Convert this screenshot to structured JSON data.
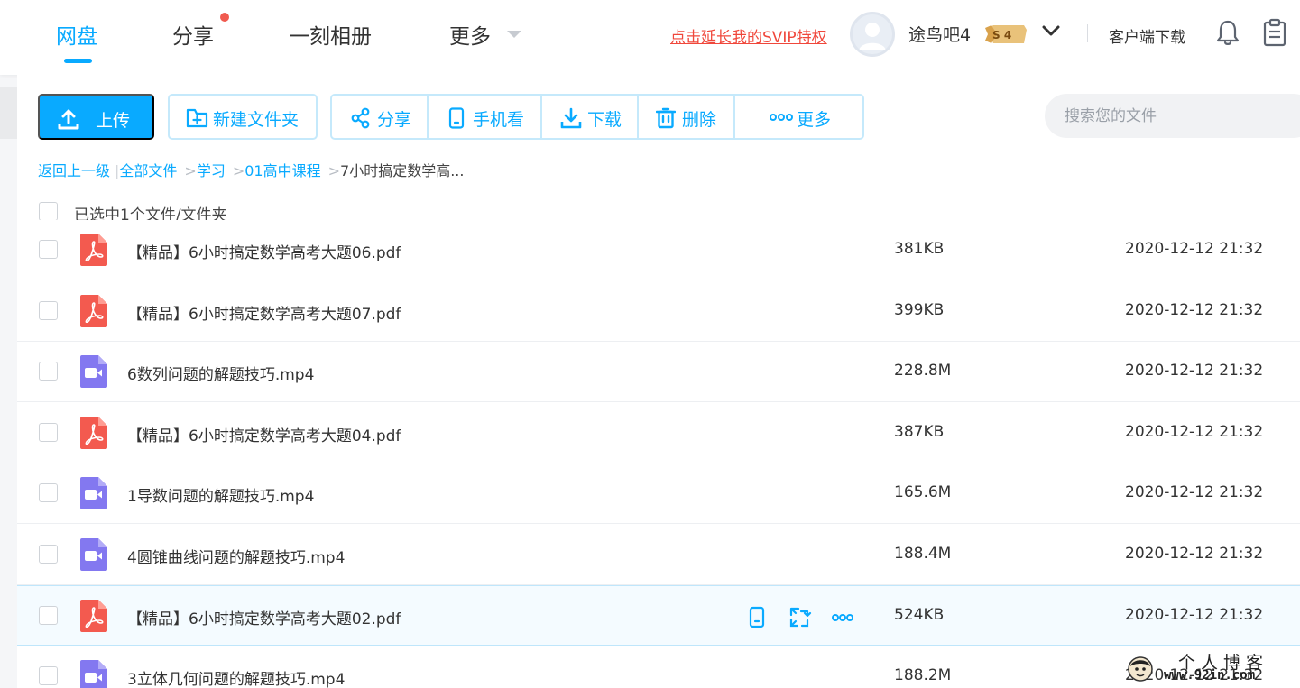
{
  "nav": {
    "tabs": [
      {
        "label": "网盘",
        "active": true
      },
      {
        "label": "分享"
      },
      {
        "label": "一刻相册"
      },
      {
        "label": "更多"
      }
    ],
    "svip_link": "点击延长我的SVIP特权",
    "username": "途鸟吧4",
    "vip_badge": "S 4",
    "client_download": "客户端下载"
  },
  "toolbar": {
    "upload": "上传",
    "new_folder": "新建文件夹",
    "share": "分享",
    "phone_view": "手机看",
    "download": "下载",
    "delete": "删除",
    "more": "更多"
  },
  "search": {
    "placeholder": "搜索您的文件"
  },
  "breadcrumb": {
    "back": "返回上一级",
    "all_files": "全部文件",
    "level1": "学习",
    "level2": "01高中课程",
    "current": "7小时搞定数学高..."
  },
  "selection": {
    "text": "已选中1个文件/文件夹"
  },
  "files": [
    {
      "type": "pdf",
      "name": "【精品】6小时搞定数学高考大题06.pdf",
      "size": "381KB",
      "date": "2020-12-12 21:32"
    },
    {
      "type": "pdf",
      "name": "【精品】6小时搞定数学高考大题07.pdf",
      "size": "399KB",
      "date": "2020-12-12 21:32"
    },
    {
      "type": "mp4",
      "name": "6数列问题的解题技巧.mp4",
      "size": "228.8M",
      "date": "2020-12-12 21:32"
    },
    {
      "type": "pdf",
      "name": "【精品】6小时搞定数学高考大题04.pdf",
      "size": "387KB",
      "date": "2020-12-12 21:32"
    },
    {
      "type": "mp4",
      "name": "1导数问题的解题技巧.mp4",
      "size": "165.6M",
      "date": "2020-12-12 21:32"
    },
    {
      "type": "mp4",
      "name": "4圆锥曲线问题的解题技巧.mp4",
      "size": "188.4M",
      "date": "2020-12-12 21:32"
    },
    {
      "type": "pdf",
      "name": "【精品】6小时搞定数学高考大题02.pdf",
      "size": "524KB",
      "date": "2020-12-12 21:32",
      "hovered": true
    },
    {
      "type": "mp4",
      "name": "3立体几何问题的解题技巧.mp4",
      "size": "188.2M",
      "date": "2020-12-12 21:32"
    }
  ],
  "watermark": {
    "title": "个人博客",
    "url": "www.92in.com"
  },
  "colors": {
    "accent": "#09aaff",
    "pdf": "#f35a4f",
    "video": "#8378f0",
    "svip": "#f0473b"
  }
}
